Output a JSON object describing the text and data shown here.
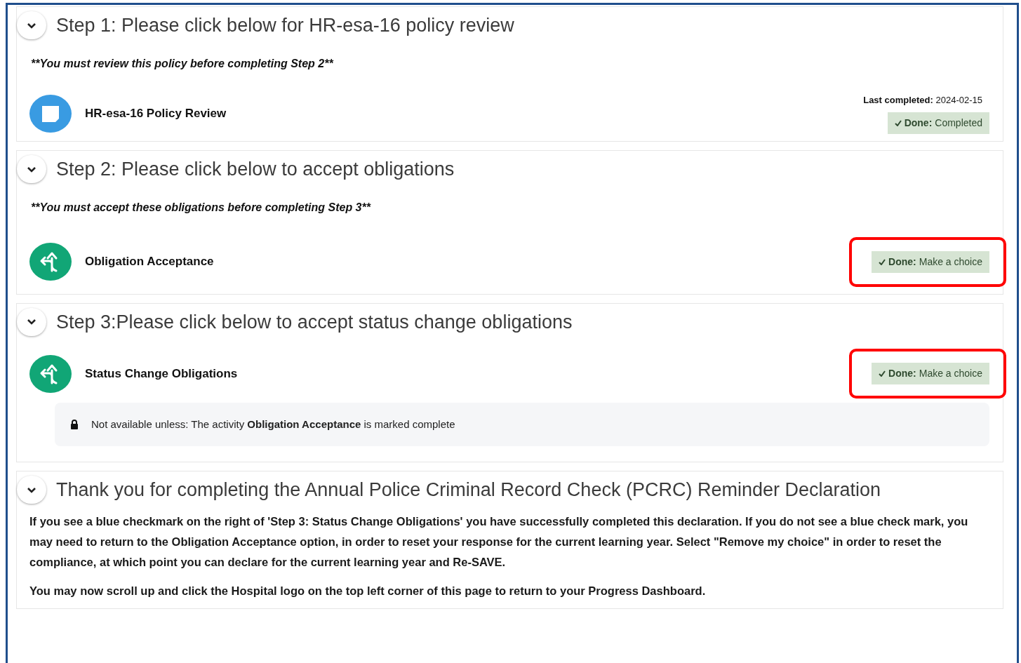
{
  "sections": [
    {
      "title": "Step 1: Please click below for HR-esa-16 policy review",
      "expanded": true,
      "note": "**You must review this policy before completing Step 2**",
      "activities": [
        {
          "name": "HR-esa-16 Policy Review",
          "kind": "page",
          "last_completed_label": "Last completed:",
          "last_completed": "2024-02-15",
          "status_label": "Done:",
          "status": "Completed",
          "highlighted": false
        }
      ]
    },
    {
      "title": "Step 2: Please click below to accept obligations",
      "expanded": true,
      "note": "**You must accept these obligations before completing Step 3**",
      "activities": [
        {
          "name": "Obligation Acceptance",
          "kind": "choice",
          "status_label": "Done:",
          "status": "Make a choice",
          "highlighted": true
        }
      ]
    },
    {
      "title": "Step 3:Please click below to accept status change obligations",
      "expanded": true,
      "activities": [
        {
          "name": "Status Change Obligations",
          "kind": "choice",
          "status_label": "Done:",
          "status": "Make a choice",
          "highlighted": true,
          "restriction": "Not available unless: The activity **Obligation Acceptance** is marked complete"
        }
      ]
    },
    {
      "title": "Thank you for completing the Annual Police Criminal Record Check (PCRC) Reminder Declaration",
      "expanded": true,
      "paragraphs": [
        "If you see a blue checkmark on the right of 'Step 3: Status Change Obligations' you have successfully completed this declaration. If you do not see a blue check mark, you may need to return to the Obligation Acceptance option, in order to reset your response for the current learning year. Select \"Remove my choice\" in order to reset the compliance, at which point you can declare for the current learning year and Re-SAVE.",
        "You may now scroll up and click the Hospital logo on the top left corner of this page to return to your Progress Dashboard."
      ]
    }
  ]
}
